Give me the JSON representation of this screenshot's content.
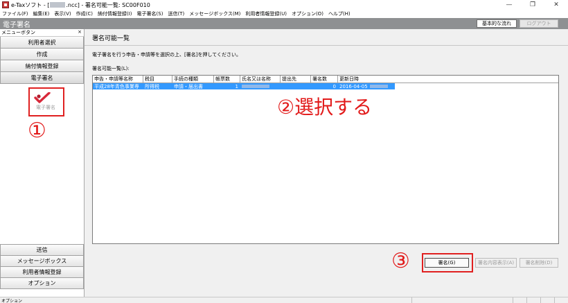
{
  "window": {
    "title_prefix": "e-Taxソフト - [",
    "title_file": ".ncc]",
    "title_suffix": "- 署名可能一覧: SC00F010",
    "minimize": "—",
    "restore": "❐",
    "close": "✕"
  },
  "menu": [
    "ファイル(F)",
    "編集(E)",
    "表示(V)",
    "作成(C)",
    "納付情報登録(I)",
    "電子署名(S)",
    "送信(T)",
    "メッセージボックス(M)",
    "利用者情報登録(U)",
    "オプション(O)",
    "ヘルプ(H)"
  ],
  "header": {
    "title": "電子署名",
    "basic_flow_button": "基本的な流れ",
    "logout_button": "ログアウト"
  },
  "sidebar": {
    "header": "メニューボタン",
    "close": "×",
    "top_items": [
      "利用者選択",
      "作成",
      "納付情報登録",
      "電子署名"
    ],
    "signature_icon_label": "電子署名",
    "bottom_items": [
      "送信",
      "メッセージボックス",
      "利用者情報登録",
      "オプション"
    ]
  },
  "main": {
    "title": "署名可能一覧",
    "instruction": "電子署名を行う申告・申請等を選択の上、[署名]を押してください。",
    "list_label": "署名可能一覧(L):",
    "columns": [
      "申告・申請等名称",
      "税目",
      "手続の種類",
      "帳票数",
      "氏名又は名称",
      "提出先",
      "署名数",
      "更新日時"
    ],
    "rows": [
      {
        "name": "平成28年青色事業専",
        "tax": "所得税",
        "procedure": "申請・届出書",
        "forms": "1",
        "holder": "",
        "submit_to": "",
        "signatures": "0",
        "updated": "2016-04-05"
      }
    ],
    "buttons": {
      "sign": "署名(G)",
      "view_signature": "署名内容表示(A)",
      "delete_signature": "署名削除(D)"
    }
  },
  "annotations": {
    "step1": "①",
    "step2": "②選択する",
    "step3": "③"
  },
  "status": {
    "text": "オプション"
  },
  "colors": {
    "selection": "#3399ff",
    "annotation_red": "#e21a1a",
    "header_gray": "#8e9092"
  }
}
